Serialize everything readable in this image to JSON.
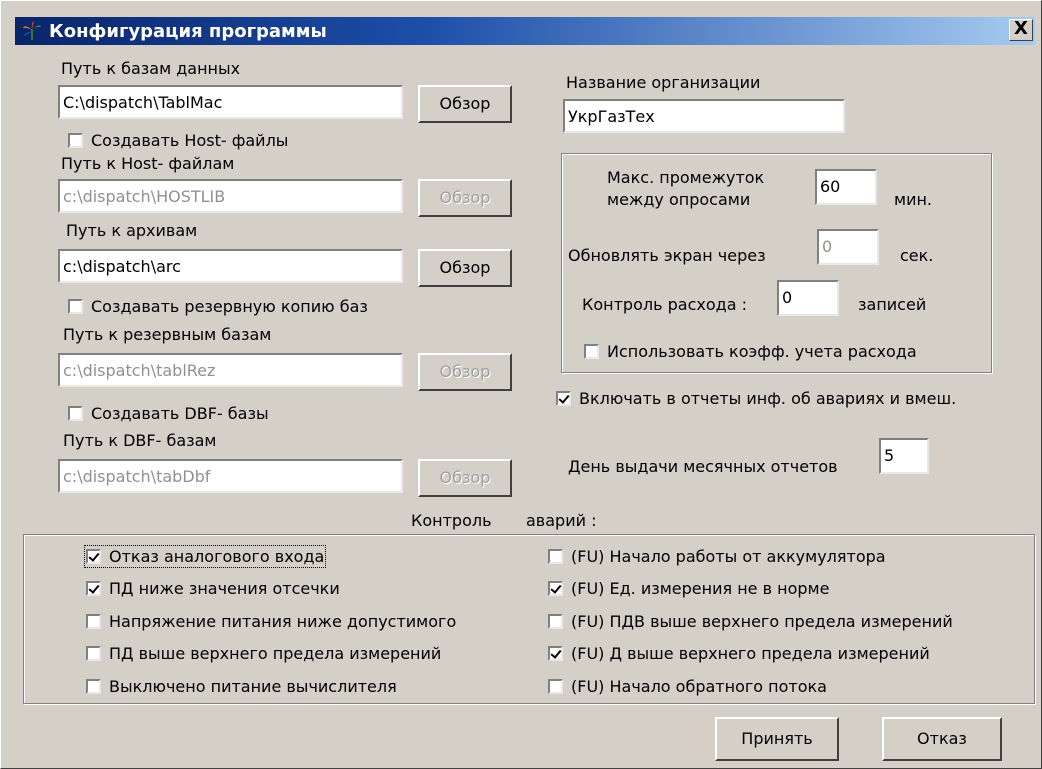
{
  "window": {
    "title": "Конфигурация программы",
    "close": "X"
  },
  "db": {
    "label": "Путь к базам данных",
    "path": "C:\\dispatch\\TablMac",
    "browse": "Обзор"
  },
  "host": {
    "checkbox": "Создавать Host- файлы",
    "checked": false,
    "label": "Путь к Host- файлам",
    "path": "c:\\dispatch\\HOSTLIB",
    "browse": "Обзор"
  },
  "archive": {
    "label": "Путь к архивам",
    "path": "c:\\dispatch\\arc",
    "browse": "Обзор"
  },
  "backup": {
    "checkbox": "Создавать резервную копию баз",
    "checked": false,
    "label": "Путь к резервным базам",
    "path": "c:\\dispatch\\tablRez",
    "browse": "Обзор"
  },
  "dbf": {
    "checkbox": "Создавать DBF- базы",
    "checked": false,
    "label": "Путь к DBF- базам",
    "path": "c:\\dispatch\\tabDbf",
    "browse": "Обзор"
  },
  "org": {
    "label": "Название организации",
    "value": "УкрГазТех"
  },
  "polling": {
    "max_interval_line1": "Макс. промежуток",
    "max_interval_line2": "между опросами",
    "max_interval_value": "60",
    "max_interval_unit": "мин.",
    "refresh_label": "Обновлять экран через",
    "refresh_value": "0",
    "refresh_unit": "сек.",
    "flow_control_label": "Контроль расхода :",
    "flow_control_value": "0",
    "flow_control_unit": "записей",
    "coef_checkbox": "Использовать коэфф. учета расхода",
    "coef_checked": false
  },
  "include_accidents": {
    "label": "Включать в отчеты инф. об авариях и вмеш.",
    "checked": true
  },
  "report_day": {
    "label": "День выдачи месячных отчетов",
    "value": "5"
  },
  "alarms": {
    "title_part1": "Контроль",
    "title_part2": "аварий :",
    "left": [
      {
        "label": "Отказ аналогового входа",
        "checked": true
      },
      {
        "label": "ПД ниже значения отсечки",
        "checked": true
      },
      {
        "label": "Напряжение питания ниже допустимого",
        "checked": false
      },
      {
        "label": "ПД выше верхнего предела измерений",
        "checked": false
      },
      {
        "label": "Выключено питание вычислителя",
        "checked": false
      }
    ],
    "right": [
      {
        "label": "(FU) Начало работы от аккумулятора",
        "checked": false
      },
      {
        "label": "(FU) Ед. измерения не в норме",
        "checked": true
      },
      {
        "label": "(FU) ПДВ выше верхнего предела измерений",
        "checked": false
      },
      {
        "label": "(FU) Д выше верхнего предела измерений",
        "checked": true
      },
      {
        "label": "(FU) Начало обратного потока",
        "checked": false
      }
    ]
  },
  "buttons": {
    "accept": "Принять",
    "cancel": "Отказ"
  }
}
